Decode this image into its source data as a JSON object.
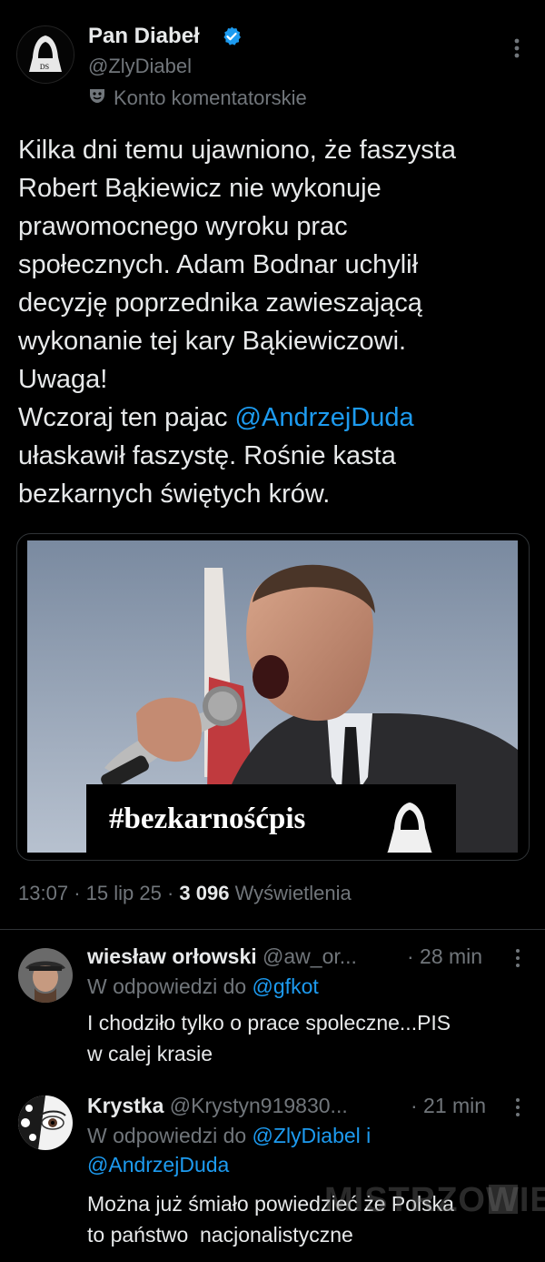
{
  "post": {
    "author_name": "Pan Diabeł",
    "handle": "@ZlyDiabel",
    "account_label": "Konto komentatorskie",
    "avatar_text": "DS",
    "text_part1": "Kilka dni temu ujawniono, że faszysta\nRobert Bąkiewicz nie wykonuje\nprawomocnego wyroku prac\nspołecznych. Adam Bodnar uchylił\ndecyzję poprzednika zawieszającą\nwykonanie tej kary Bąkiewiczowi.\nUwaga!\nWczoraj ten pajac ",
    "mention": "@AndrzejDuda",
    "text_part2": "\nułaskawił faszystę. Rośnie kasta\nbezkarnych świętych krów.",
    "image_hashtag": "#bezkarnośćpis",
    "image_logo_text": "DS",
    "time": "13:07",
    "date": "15 lip 25",
    "views_count": "3 096",
    "views_label": "Wyświetlenia",
    "dot": "·",
    "accent_color": "#1d9bf0"
  },
  "replies": [
    {
      "name": "wiesław orłowski",
      "handle": "@aw_or...",
      "time": "· 28 min",
      "reply_to_label": "W odpowiedzi do",
      "reply_to": "@gfkot",
      "text": "I chodziło tylko o prace spoleczne...PIS\nw calej krasie"
    },
    {
      "name": "Krystka",
      "handle": "@Krystyn919830...",
      "time": "· 21 min",
      "reply_to_label": "W odpowiedzi do",
      "reply_to": "@ZlyDiabel i",
      "reply_to_2": "@AndrzejDuda",
      "text": "Można już śmiało powiedzieć że Polska\nto państwo  nacjonalistyczne"
    }
  ],
  "watermark": "MISTRZOWIE"
}
